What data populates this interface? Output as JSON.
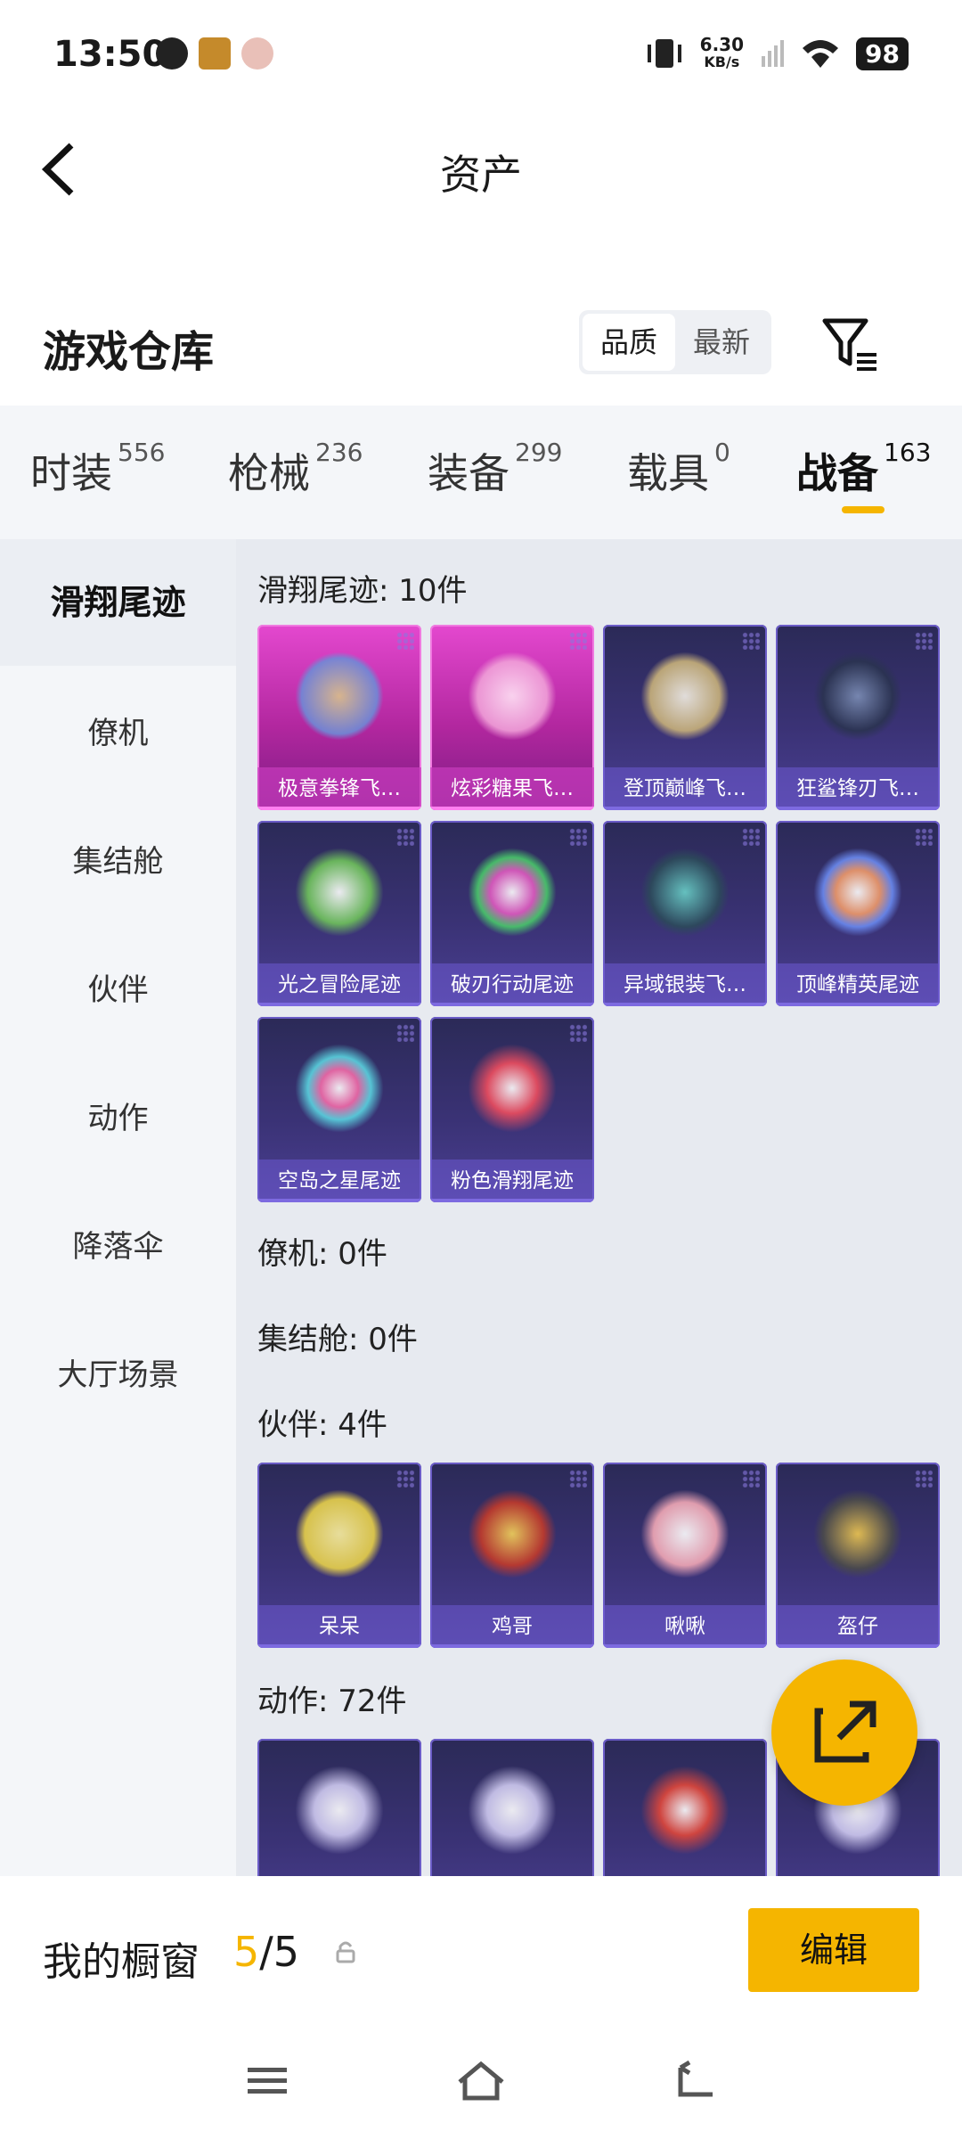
{
  "status_bar": {
    "time": "13:50",
    "net_speed_value": "6.30",
    "net_speed_unit": "KB/s",
    "battery": "98"
  },
  "header": {
    "title": "资产"
  },
  "warehouse": {
    "title": "游戏仓库",
    "sort_options": [
      "品质",
      "最新"
    ],
    "sort_selected": "品质"
  },
  "tabs": [
    {
      "label": "时装",
      "count": "556"
    },
    {
      "label": "枪械",
      "count": "236"
    },
    {
      "label": "装备",
      "count": "299"
    },
    {
      "label": "载具",
      "count": "0"
    },
    {
      "label": "战备",
      "count": "163"
    }
  ],
  "active_tab": "战备",
  "sidebar": {
    "items": [
      "滑翔尾迹",
      "僚机",
      "集结舱",
      "伙伴",
      "动作",
      "降落伞",
      "大厅场景"
    ],
    "active": "滑翔尾迹"
  },
  "sections": {
    "glide": {
      "title": "滑翔尾迹: 10件",
      "items": [
        "极意拳锋飞…",
        "炫彩糖果飞…",
        "登顶巅峰飞…",
        "狂鲨锋刃飞…",
        "光之冒险尾迹",
        "破刃行动尾迹",
        "异域银装飞…",
        "顶峰精英尾迹",
        "空岛之星尾迹",
        "粉色滑翔尾迹"
      ]
    },
    "wingman": {
      "title": "僚机: 0件"
    },
    "pod": {
      "title": "集结舱: 0件"
    },
    "partner": {
      "title": "伙伴: 4件",
      "items": [
        "呆呆",
        "鸡哥",
        "啾啾",
        "盔仔"
      ]
    },
    "emote": {
      "title": "动作: 72件"
    }
  },
  "showcase": {
    "label": "我的橱窗",
    "current": "5",
    "separator": "/",
    "total": "5",
    "edit_label": "编辑"
  },
  "colors": {
    "accent": "#f5b500",
    "card_purple": "#3a3275",
    "card_pink": "#d23cc0"
  }
}
